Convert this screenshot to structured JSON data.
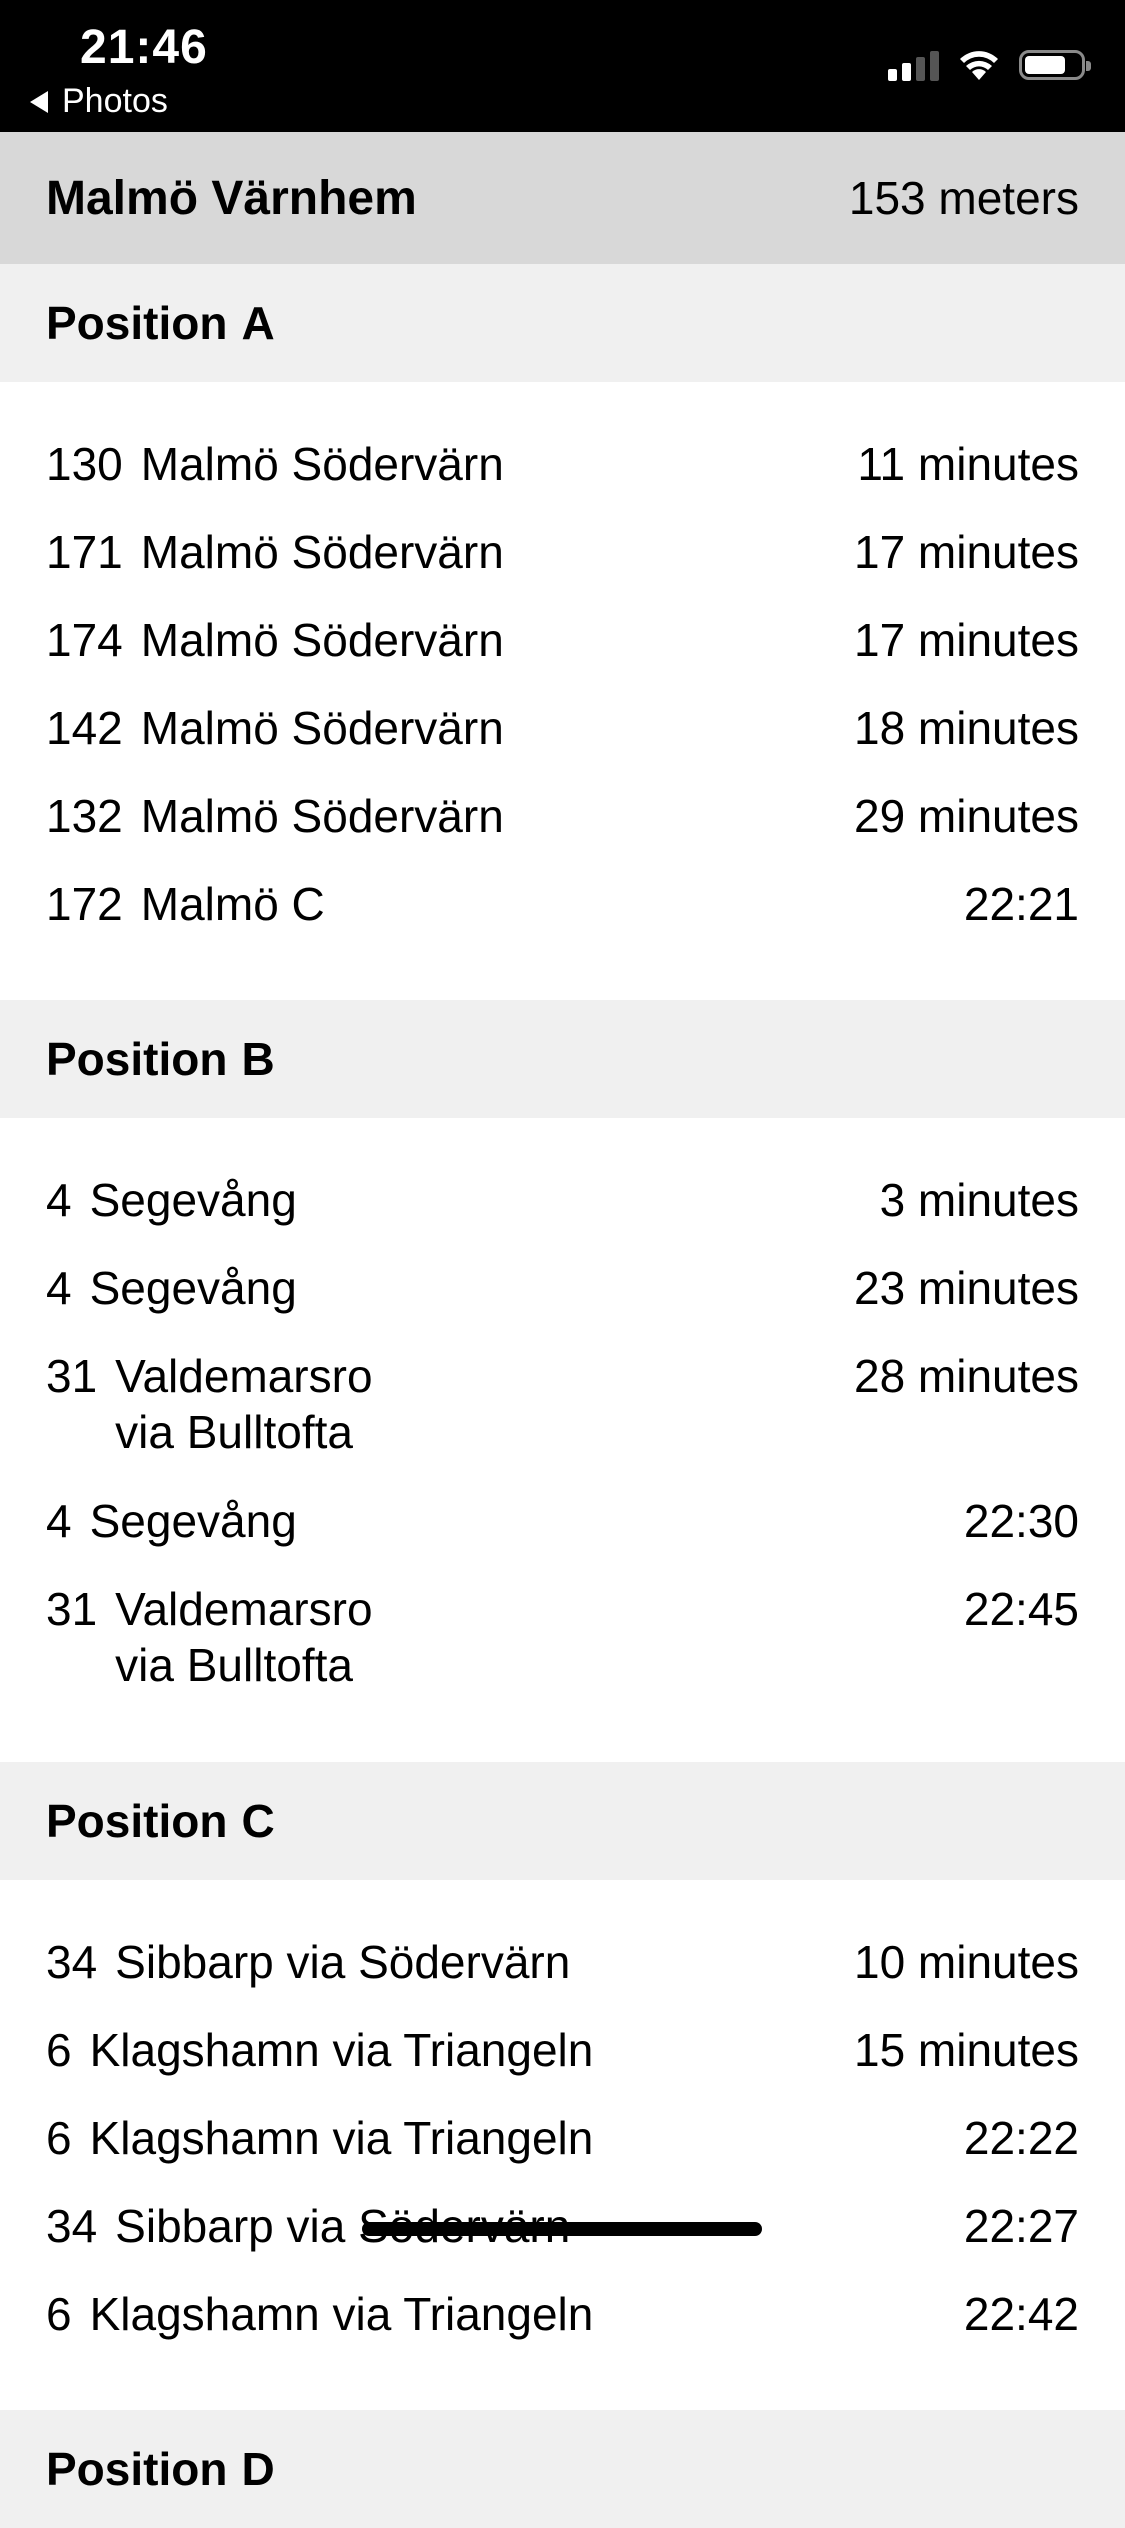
{
  "status_bar": {
    "time": "21:46",
    "back_label": "Photos"
  },
  "header": {
    "stop_name": "Malmö Värnhem",
    "distance": "153 meters"
  },
  "sections": [
    {
      "label": "Position",
      "letter": "A",
      "departures": [
        {
          "route": "130",
          "destination": "Malmö Södervärn",
          "via": "",
          "time": "11 minutes"
        },
        {
          "route": "171",
          "destination": "Malmö Södervärn",
          "via": "",
          "time": "17 minutes"
        },
        {
          "route": "174",
          "destination": "Malmö Södervärn",
          "via": "",
          "time": "17 minutes"
        },
        {
          "route": "142",
          "destination": "Malmö Södervärn",
          "via": "",
          "time": "18 minutes"
        },
        {
          "route": "132",
          "destination": "Malmö Södervärn",
          "via": "",
          "time": "29 minutes"
        },
        {
          "route": "172",
          "destination": "Malmö C",
          "via": "",
          "time": "22:21"
        }
      ]
    },
    {
      "label": "Position",
      "letter": "B",
      "departures": [
        {
          "route": "4",
          "destination": "Segevång",
          "via": "",
          "time": "3 minutes"
        },
        {
          "route": "4",
          "destination": "Segevång",
          "via": "",
          "time": "23 minutes"
        },
        {
          "route": "31",
          "destination": "Valdemarsro",
          "via": "via Bulltofta",
          "time": "28 minutes"
        },
        {
          "route": "4",
          "destination": "Segevång",
          "via": "",
          "time": "22:30"
        },
        {
          "route": "31",
          "destination": "Valdemarsro",
          "via": "via Bulltofta",
          "time": "22:45"
        }
      ]
    },
    {
      "label": "Position",
      "letter": "C",
      "departures": [
        {
          "route": "34",
          "destination": "Sibbarp via Södervärn",
          "via": "",
          "time": "10 minutes"
        },
        {
          "route": "6",
          "destination": "Klagshamn via Triangeln",
          "via": "",
          "time": "15 minutes"
        },
        {
          "route": "6",
          "destination": "Klagshamn via Triangeln",
          "via": "",
          "time": "22:22"
        },
        {
          "route": "34",
          "destination": "Sibbarp via Södervärn",
          "via": "",
          "time": "22:27"
        },
        {
          "route": "6",
          "destination": "Klagshamn via Triangeln",
          "via": "",
          "time": "22:42"
        }
      ]
    },
    {
      "label": "Position",
      "letter": "D",
      "departures": []
    }
  ]
}
